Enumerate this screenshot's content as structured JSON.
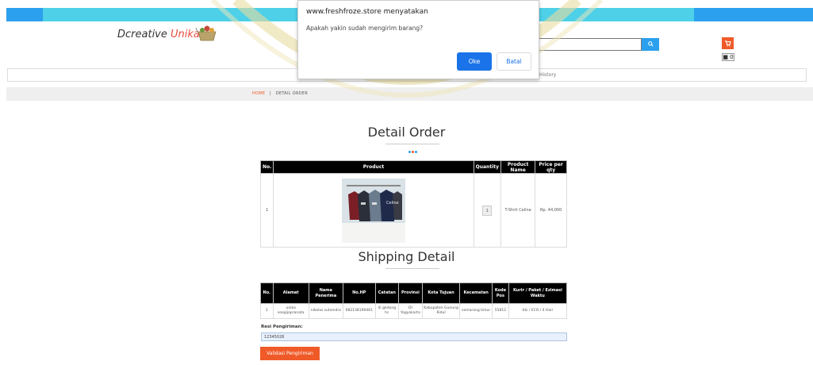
{
  "header": {
    "logo_prefix": "D",
    "logo_main": "creative",
    "logo_accent": "Unika",
    "cart_count": "0",
    "nav_history": "History"
  },
  "breadcrumb": {
    "home": "HOME",
    "separator": "|",
    "current": "DETAIL ORDER"
  },
  "detail_order": {
    "title": "Detail Order",
    "columns": [
      "No.",
      "Product",
      "Quantity",
      "Product Name",
      "Price per qty"
    ],
    "rows": [
      {
        "no": "1",
        "quantity": "1",
        "product_name": "T-Shirt Celine",
        "price": "Rp. 44,000"
      }
    ]
  },
  "shipping": {
    "title": "Shipping Detail",
    "columns": [
      "No.",
      "Alamat",
      "Nama Penerima",
      "No.HP",
      "Catatan",
      "Provinsi",
      "Kota Tujuan",
      "Kecamatan",
      "Kode Pos",
      "Kurir / Paket / Ezimasi Waktu"
    ],
    "rows": [
      {
        "no": "1",
        "alamat": "unika soegijapranata",
        "nama": "nikolas suhendra",
        "hp": "082138199461",
        "catatan": "di gedung hc",
        "provinsi": "DI Yogyakarta",
        "kota": "Kabupaten Gunung Kidul",
        "kecamatan": "semarang timur",
        "kodepos": "55812",
        "kurir": "tiki / ECO / 4 Hari"
      }
    ]
  },
  "resi": {
    "label": "Resi Pengiriman:",
    "value": "12345026"
  },
  "validate_button": "Validasi Pengiriman",
  "dialog": {
    "site": "www.freshfroze.store menyatakan",
    "message": "Apakah yakin sudah mengirim barang?",
    "ok": "Oke",
    "cancel": "Batal"
  },
  "colors": {
    "accent_orange": "#f05a28",
    "accent_blue": "#2ba0ee",
    "topbar_cyan": "#4dd0e8",
    "dialog_blue": "#1a73e8"
  },
  "icons": {
    "search": "search-icon",
    "cart": "cart-icon"
  }
}
